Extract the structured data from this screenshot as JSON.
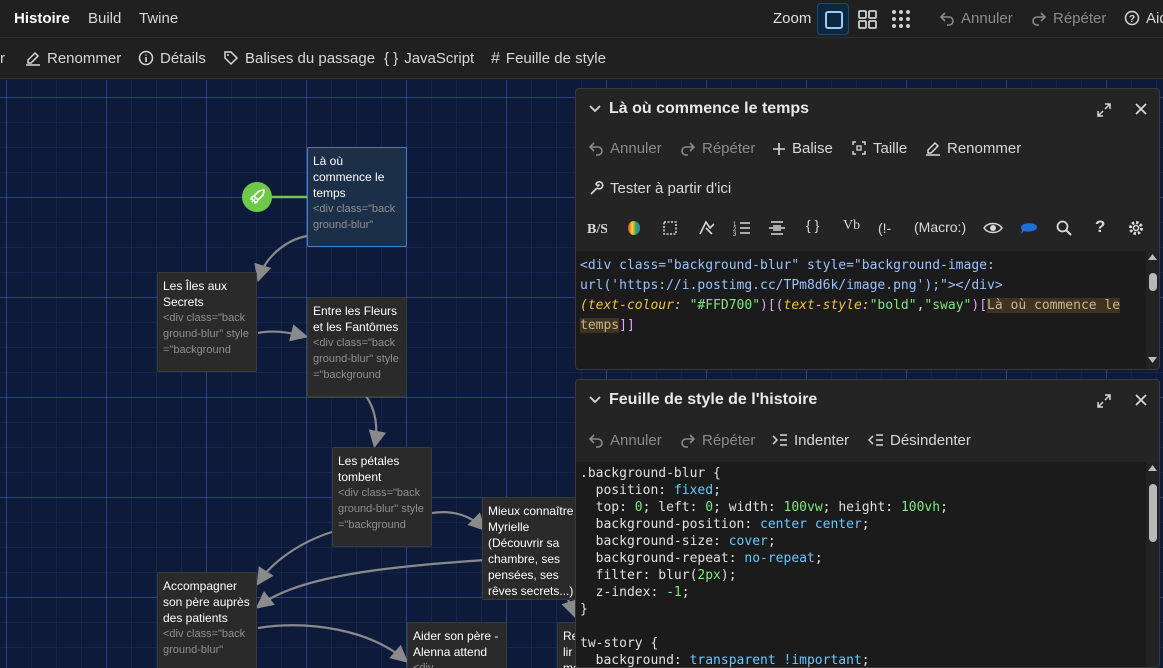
{
  "topbar": {
    "tabs": [
      "Histoire",
      "Build",
      "Twine"
    ],
    "zoom_label": "Zoom",
    "undo": "Annuler",
    "redo": "Répéter",
    "help": "Aide"
  },
  "subbar": {
    "items": [
      "Renommer",
      "Détails",
      "Balises du passage",
      "JavaScript",
      "Feuille de style"
    ]
  },
  "passages": [
    {
      "title": "Là où commence le temps",
      "excerpt": "<div class=\"background-blur\""
    },
    {
      "title": "Les Îles aux Secrets",
      "excerpt": "<div class=\"background-blur\" style=\"background"
    },
    {
      "title": "Entre les Fleurs et les Fantômes",
      "excerpt": "<div class=\"background-blur\" style=\"background"
    },
    {
      "title": "Les pétales tombent",
      "excerpt": "<div class=\"background-blur\" style=\"background"
    },
    {
      "title": "Mieux connaître Myrielle (Découvrir sa chambre, ses pensées, ses rêves secrets...)",
      "excerpt": ""
    },
    {
      "title": "Accompagner son père auprès des patients",
      "excerpt": "<div class=\"background-blur\""
    },
    {
      "title": "Aider son père - Alenna attend",
      "excerpt": "<div"
    },
    {
      "title": "Re lir mè",
      "excerpt": ""
    }
  ],
  "passage_dialog": {
    "title": "Là où commence le temps",
    "toolbar": {
      "undo": "Annuler",
      "redo": "Répéter",
      "tag": "Balise",
      "size": "Taille",
      "rename": "Renommer",
      "test": "Tester à partir d'ici"
    },
    "format_toolbar": {
      "macro": "(Macro:)"
    },
    "code": {
      "l1a": "<div class=\"background-blur\" style=\"background-image:",
      "l2": "url('https://i.postimg.cc/TPm8d6k/image.png');\"></div>",
      "m1": "(text-colour:",
      "s1": " \"#FFD700\"",
      "b1": ")[(",
      "m2": "text-style:",
      "s2": "\"bold\"",
      "c1": ",",
      "s3": "\"sway\"",
      "b2": ")[",
      "h1": "Là où commence le",
      "h2": "temps",
      "b3": "]]"
    }
  },
  "style_dialog": {
    "title": "Feuille de style de l'histoire",
    "toolbar": {
      "undo": "Annuler",
      "redo": "Répéter",
      "indent": "Indenter",
      "outdent": "Désindenter"
    },
    "code": [
      {
        "p": ".background-blur {"
      },
      {
        "k": "  position: ",
        "v": "fixed",
        "e": ";"
      },
      {
        "k": "  top: ",
        "n": "0",
        "k2": "; left: ",
        "n2": "0",
        "k3": "; width: ",
        "n3": "100vw",
        "k4": "; height: ",
        "n4": "100vh",
        "e": ";"
      },
      {
        "k": "  background-position: ",
        "v": "center center",
        "e": ";"
      },
      {
        "k": "  background-size: ",
        "v": "cover",
        "e": ";"
      },
      {
        "k": "  background-repeat: ",
        "v": "no-repeat",
        "e": ";"
      },
      {
        "k": "  filter: blur(",
        "n": "2px",
        "e": ");"
      },
      {
        "k": "  z-index: ",
        "n": "-1",
        "e": ";"
      },
      {
        "p": "}"
      },
      {
        "p": ""
      },
      {
        "p": "tw-story {"
      },
      {
        "k": "  background: ",
        "v": "transparent !important",
        "e": ";"
      }
    ]
  }
}
